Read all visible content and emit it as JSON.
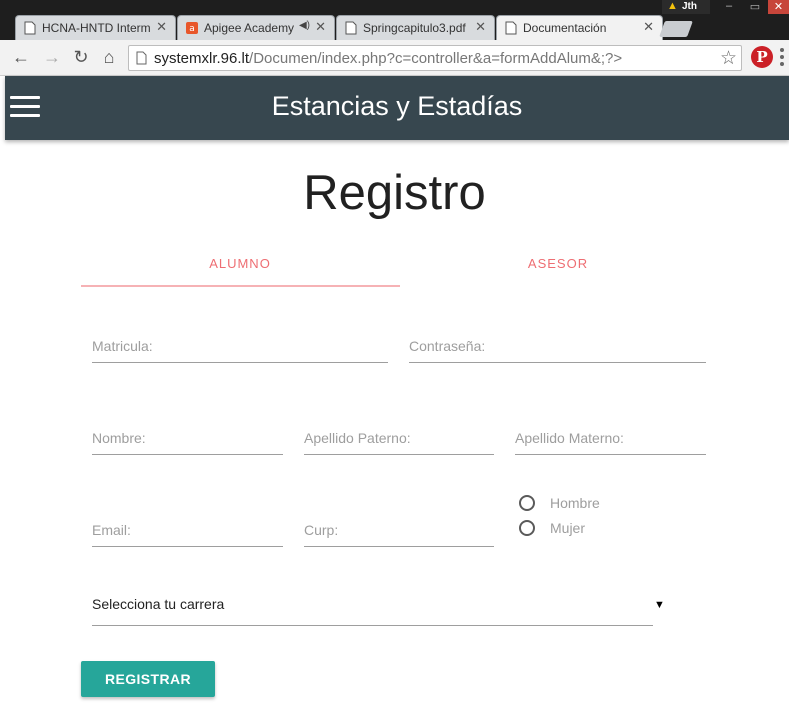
{
  "browser": {
    "tabs": [
      {
        "title": "HCNA-HNTD Interm",
        "active": false
      },
      {
        "title": "Apigee Academy",
        "active": false
      },
      {
        "title": "Springcapitulo3.pdf",
        "active": false
      },
      {
        "title": "Documentación",
        "active": true
      }
    ],
    "user_badge": "Jth",
    "url_host": "systemxlr.96.lt",
    "url_path": "/Documen/index.php?c=controller&a=formAddAlum&;?>"
  },
  "app": {
    "brand": "Estancias y Estadías",
    "title": "Registro"
  },
  "form_tabs": [
    "ALUMNO",
    "ASESOR"
  ],
  "fields": {
    "matricula": "Matricula:",
    "password": "Contraseña:",
    "nombre": "Nombre:",
    "apellido_paterno": "Apellido Paterno:",
    "apellido_materno": "Apellido Materno:",
    "email": "Email:",
    "curp": "Curp:"
  },
  "gender": [
    "Hombre",
    "Mujer"
  ],
  "career_select": "Selecciona tu carrera",
  "submit_label": "REGISTRAR",
  "colors": {
    "appbar": "#37474f",
    "tab_accent": "#ee6e73",
    "button": "#26a69a"
  }
}
